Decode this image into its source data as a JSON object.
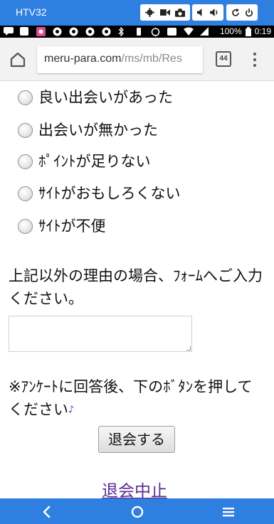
{
  "emulator": {
    "title": "HTV32"
  },
  "status_bar": {
    "battery": "100%",
    "time": "0:19"
  },
  "browser": {
    "url_host": "meru-para.com",
    "url_path": "/ms/mb/Res",
    "tab_count": "44"
  },
  "form": {
    "options": [
      "良い出会いがあった",
      "出会いが無かった",
      "ﾎﾟｲﾝﾄが足りない",
      "ｻｲﾄがおもしろくない",
      "ｻｲﾄが不便"
    ],
    "other_prompt": "上記以外の理由の場合、ﾌｫｰﾑへご入力ください。",
    "textarea_value": "",
    "note": "※ｱﾝｹｰﾄに回答後、下のﾎﾞﾀﾝを押してください",
    "note_emoji": "♪",
    "submit_label": "退会する",
    "cancel_label": "退会中止"
  },
  "colors": {
    "accent": "#2f7fe0",
    "link_visited": "#5b2c8f"
  }
}
